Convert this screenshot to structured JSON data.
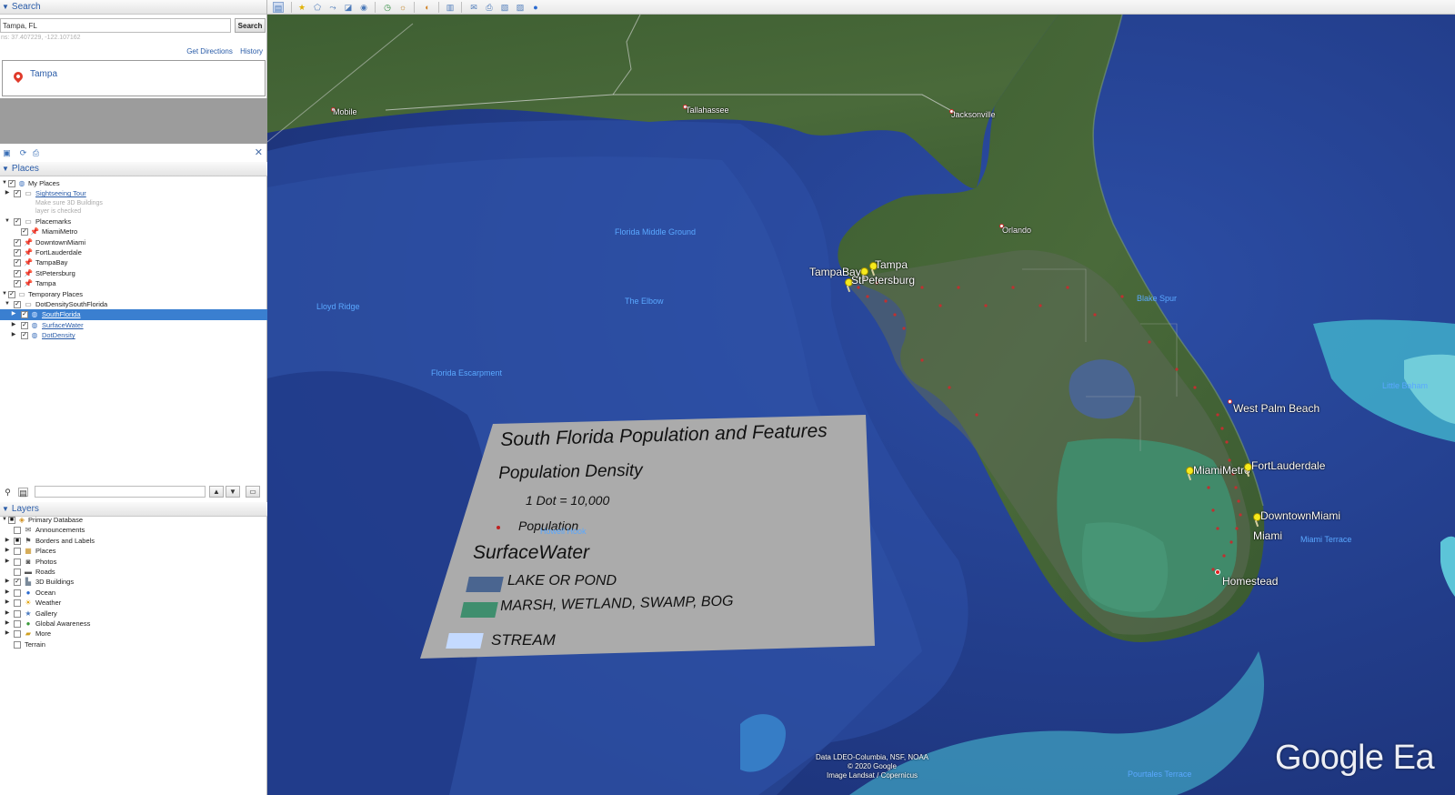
{
  "search": {
    "header": "Search",
    "query": "Tampa, FL",
    "button": "Search",
    "coords": "ns: 37.407229, -122.107162",
    "get_directions": "Get Directions",
    "history": "History",
    "result": "Tampa"
  },
  "places": {
    "header": "Places",
    "items": [
      "My Places",
      "Sightseeing Tour",
      "Make sure 3D Buildings",
      "layer is checked",
      "Placemarks",
      "MiamiMetro",
      "DowntownMiami",
      "FortLauderdale",
      "TampaBay",
      "StPetersburg",
      "Tampa",
      "Temporary Places",
      "DotDensitySouthFlorida",
      "SouthFlorida",
      "SurfaceWater",
      "DotDensity"
    ]
  },
  "layers": {
    "header": "Layers",
    "items": [
      "Primary Database",
      "Announcements",
      "Borders and Labels",
      "Places",
      "Photos",
      "Roads",
      "3D Buildings",
      "Ocean",
      "Weather",
      "Gallery",
      "Global Awareness",
      "More",
      "Terrain"
    ]
  },
  "map": {
    "labels": {
      "mobile": "Mobile",
      "tallahassee": "Tallahassee",
      "jacksonville": "Jacksonville",
      "orlando": "Orlando",
      "tampa": "Tampa",
      "tampabay": "TampaBay",
      "stpetersburg": "StPetersburg",
      "westpalmbeach": "West Palm Beach",
      "miamimetro": "MiamiMetro",
      "fortlauderdale": "FortLauderdale",
      "downtownmiami": "DowntownMiami",
      "miami": "Miami",
      "homestead": "Homestead",
      "florida_middle_ground": "Florida Middle Ground",
      "the_elbow": "The Elbow",
      "lloyd_ridge": "Lloyd Ridge",
      "florida_escarpment": "Florida Escarpment",
      "howell_hook": "Howell Hook",
      "blake_spur": "Blake Spur",
      "miami_terrace": "Miami Terrace",
      "little_bahama": "Little Baham",
      "pourtales_terrace": "Pourtales Terrace"
    },
    "legend": {
      "title": "South Florida Population and Features",
      "density_heading": "Population Density",
      "dot_value": "1 Dot = 10,000",
      "population": "Population",
      "surface_heading": "SurfaceWater",
      "lake": "LAKE OR POND",
      "marsh": "MARSH, WETLAND, SWAMP, BOG",
      "stream": "STREAM"
    },
    "attribution": [
      "Data LDEO-Columbia, NSF, NOAA",
      "© 2020 Google",
      "Image Landsat / Copernicus"
    ],
    "logo": "Google Ea",
    "colors": {
      "ocean": "#233e8a",
      "land": "#3f6034",
      "marsh": "#3f8e6e",
      "lake": "#4a6590",
      "pin": "#f6ea1c"
    }
  }
}
